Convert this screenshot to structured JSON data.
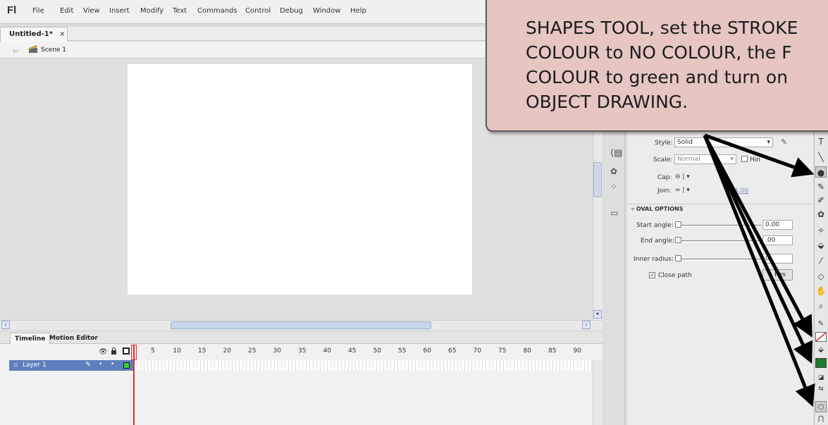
{
  "app": {
    "logo": "Fl"
  },
  "menu": {
    "items": [
      "File",
      "Edit",
      "View",
      "Insert",
      "Modify",
      "Text",
      "Commands",
      "Control",
      "Debug",
      "Window",
      "Help"
    ]
  },
  "document": {
    "tab_label": "Untitled-1*",
    "close": "×",
    "scene_label": "Scene 1"
  },
  "timeline": {
    "tabs": [
      "Timeline",
      "Motion Editor"
    ],
    "frame_numbers": [
      "5",
      "10",
      "15",
      "20",
      "25",
      "30",
      "35",
      "40",
      "45",
      "50",
      "55",
      "60",
      "65",
      "70",
      "75",
      "80",
      "85",
      "90"
    ],
    "layer_name": "Layer 1"
  },
  "properties": {
    "style_label": "Style:",
    "style_value": "Solid",
    "scale_label": "Scale:",
    "scale_value": "Normal",
    "hinting_label": "Hin",
    "cap_label": "Cap:",
    "join_label": "Join:",
    "miter_value": "3.00",
    "oval_section": "OVAL OPTIONS",
    "start_angle_label": "Start angle:",
    "start_angle_value": "0.00",
    "end_angle_label": "End angle:",
    "end_angle_value": ".00",
    "inner_radius_label": "Inner radius:",
    "inner_radius_value": "0.",
    "close_path_label": "Close path",
    "reset_label": "Res"
  },
  "colors": {
    "stroke_none": "#ffffff",
    "fill": "#1e7a30",
    "accent": "#5d7fbd"
  },
  "callout": {
    "text": "SHAPES TOOL, set the STROKE\nCOLOUR to NO COLOUR, the F\nCOLOUR to green and turn on\nOBJECT DRAWING."
  }
}
